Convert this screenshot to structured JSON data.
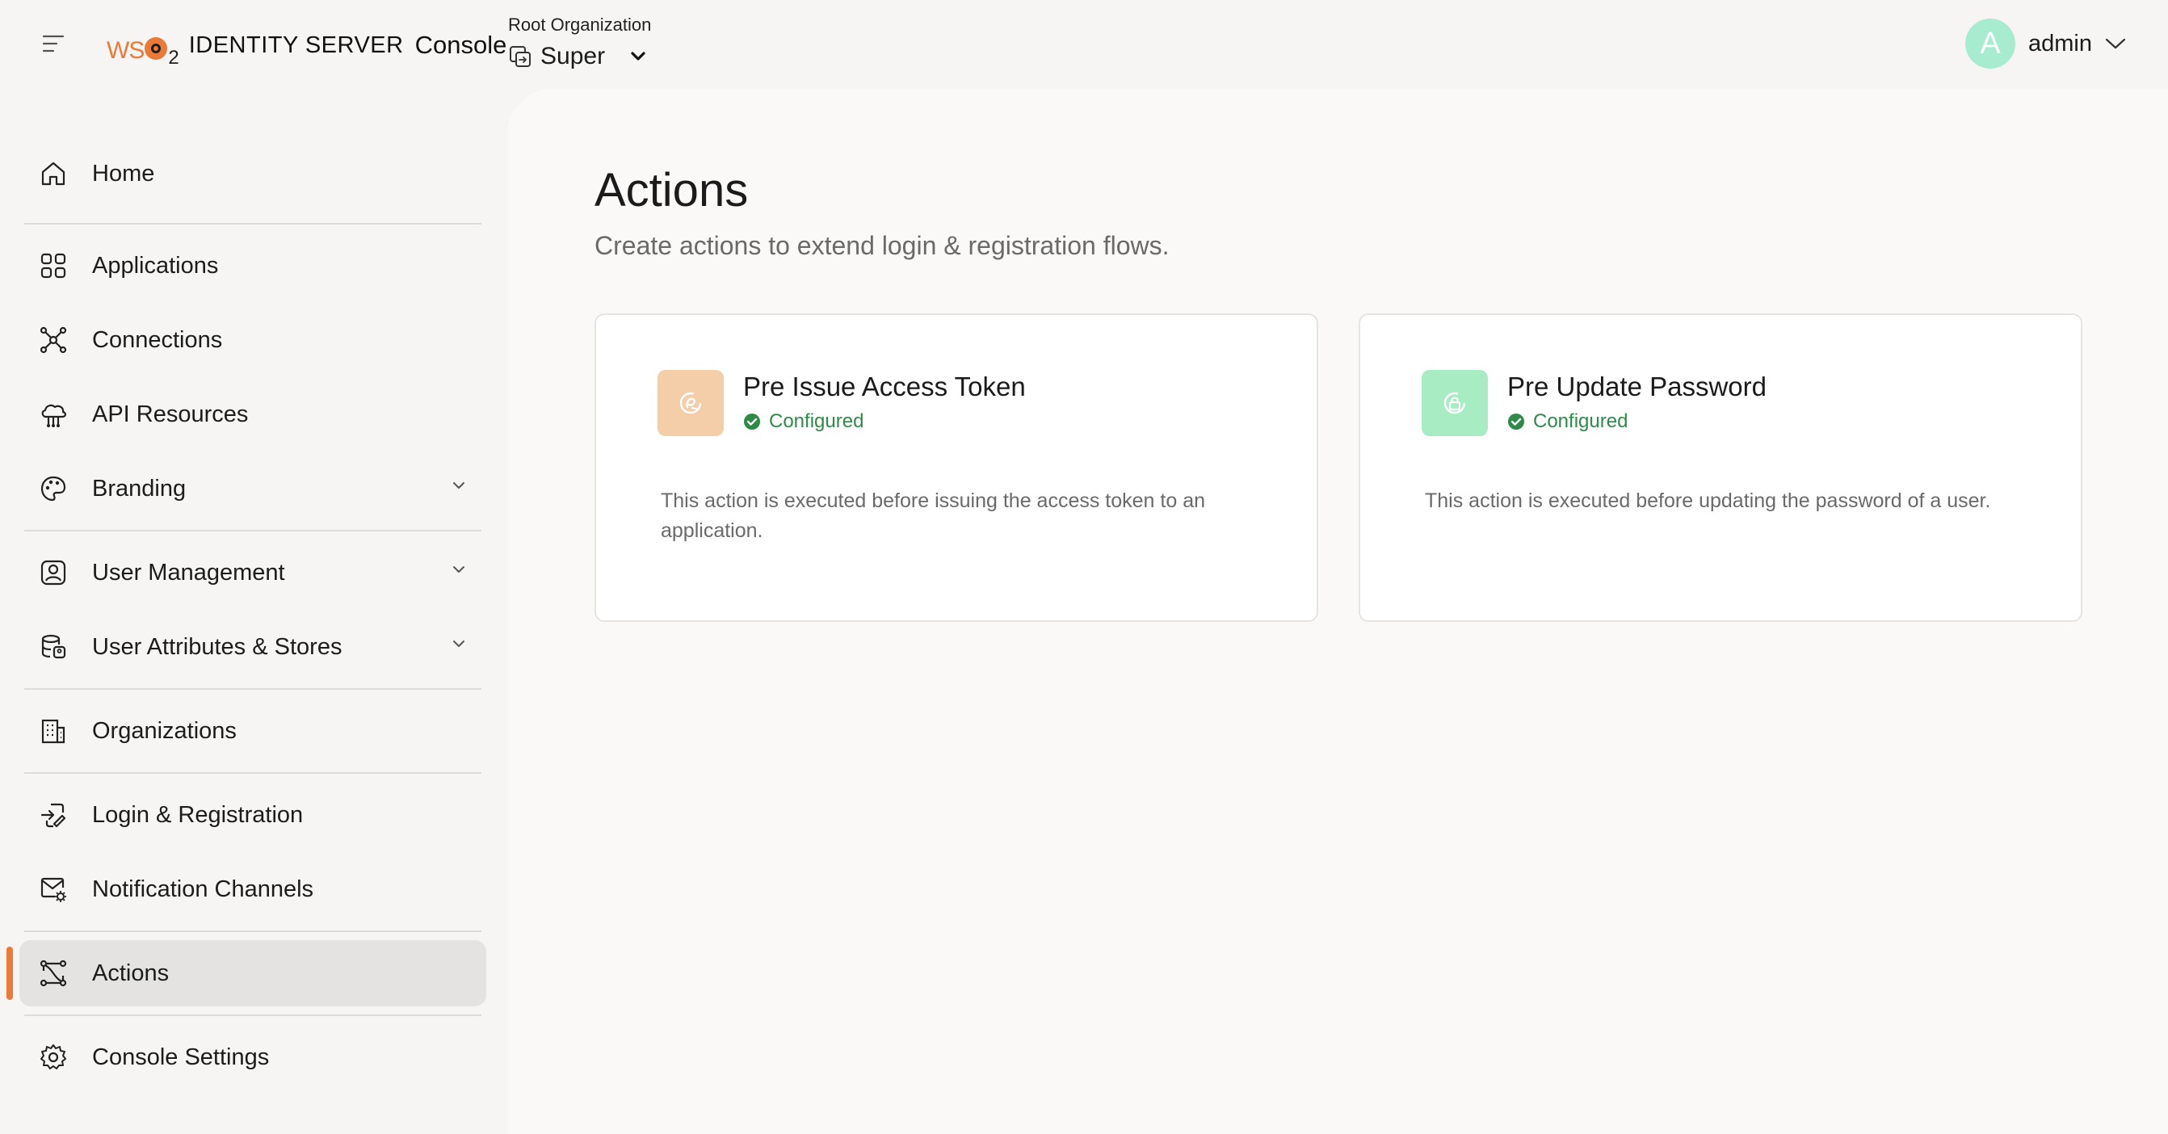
{
  "header": {
    "logo": {
      "brand": "WSO2",
      "product": "IDENTITY SERVER",
      "console": "Console"
    },
    "org_label": "Root Organization",
    "org_name": "Super",
    "user": {
      "avatar_letter": "A",
      "name": "admin"
    }
  },
  "sidebar": {
    "items": [
      {
        "label": "Home",
        "icon": "home-icon"
      },
      {
        "label": "Applications",
        "icon": "grid-icon"
      },
      {
        "label": "Connections",
        "icon": "connections-icon"
      },
      {
        "label": "API Resources",
        "icon": "cloud-api-icon"
      },
      {
        "label": "Branding",
        "icon": "palette-icon",
        "expandable": true
      },
      {
        "label": "User Management",
        "icon": "user-badge-icon",
        "expandable": true
      },
      {
        "label": "User Attributes & Stores",
        "icon": "database-icon",
        "expandable": true
      },
      {
        "label": "Organizations",
        "icon": "building-icon"
      },
      {
        "label": "Login & Registration",
        "icon": "login-flow-icon"
      },
      {
        "label": "Notification Channels",
        "icon": "mail-settings-icon"
      },
      {
        "label": "Actions",
        "icon": "actions-flow-icon",
        "active": true
      },
      {
        "label": "Console Settings",
        "icon": "gear-icon"
      }
    ]
  },
  "main": {
    "title": "Actions",
    "subtitle": "Create actions to extend login & registration flows.",
    "cards": [
      {
        "title": "Pre Issue Access Token",
        "status": "Configured",
        "description": "This action is executed before issuing the access token to an application.",
        "icon_color": "#f4cda9"
      },
      {
        "title": "Pre Update Password",
        "status": "Configured",
        "description": "This action is executed before updating the password of a user.",
        "icon_color": "#a8ecc4"
      }
    ]
  },
  "colors": {
    "accent": "#eb7a38",
    "success": "#2f8a4a",
    "avatar": "#a8ecd0",
    "active_bg": "#e4e3e1"
  }
}
